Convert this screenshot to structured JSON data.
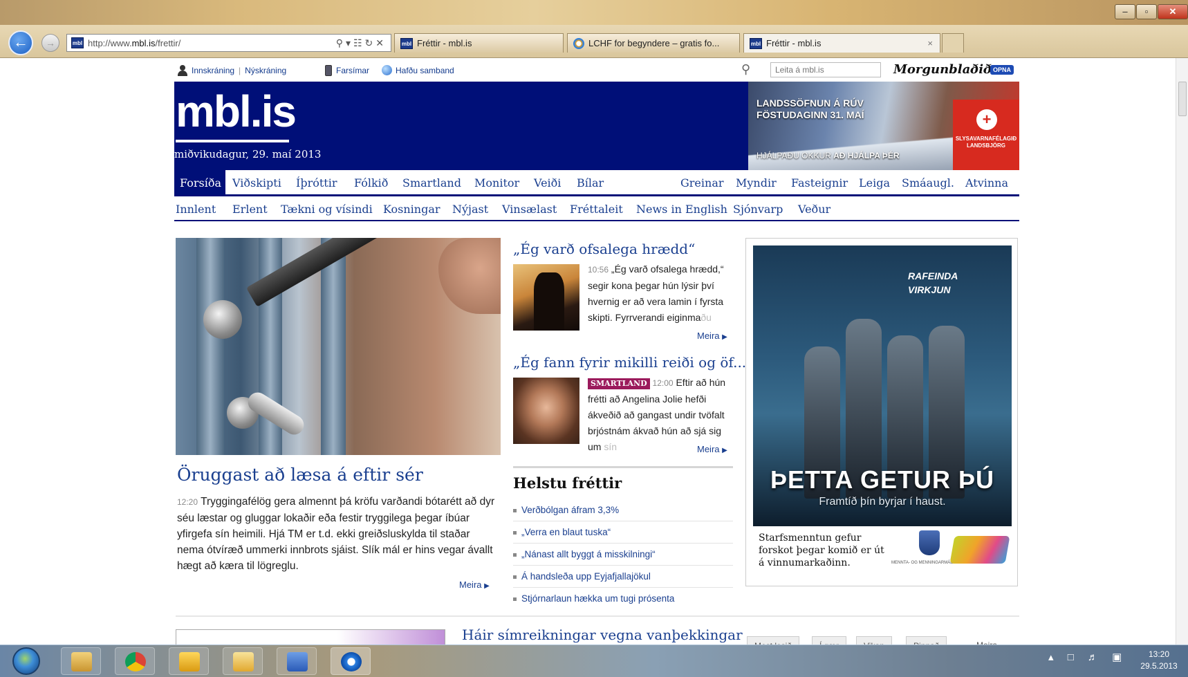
{
  "browser": {
    "address_url_prefix": "http://www.",
    "address_url_host": "mbl.is",
    "address_url_path": "/frettir/",
    "tabs": [
      {
        "label": "Fréttir - mbl.is",
        "favicon": "mbl-favicon"
      },
      {
        "label": "LCHF for begyndere – gratis fo...",
        "favicon": "ie-favicon"
      },
      {
        "label": "Fréttir - mbl.is",
        "favicon": "mbl-favicon",
        "active": true
      }
    ],
    "tab_close": "×",
    "window_buttons": {
      "minimize": "–",
      "maximize": "▫",
      "close": "✕"
    },
    "favicon_text": "mbl"
  },
  "utility": {
    "login": "Innskráning",
    "register": "Nýskráning",
    "divider": "|",
    "phones": "Farsímar",
    "contact": "Hafðu samband",
    "search_placeholder": "Leita á mbl.is",
    "newspaper": "Morgunblaðið",
    "opna": "OPNA"
  },
  "header": {
    "logo": "mbl.is",
    "date": "miðvikudagur, 29. maí 2013",
    "banner": {
      "line1": "LANDSSÖFNUN Á RÚV",
      "line2": "FÖSTUDAGINN 31. MAÍ",
      "line3_prefix": "HJÁLPAÐU OKKUR ",
      "line3_bold": "AÐ HJÁLPA ÞÉR",
      "org": "SLYSAVARNAFÉLAGIÐ LANDSBJÖRG",
      "accent": "#d72a1f"
    }
  },
  "main_nav": {
    "items": [
      "Forsíða",
      "Viðskipti",
      "Íþróttir",
      "Fólkið",
      "Smartland",
      "Monitor",
      "Veiði",
      "Bílar"
    ],
    "right_items": [
      "Greinar",
      "Myndir",
      "Fasteignir",
      "Leiga",
      "Smáaugl.",
      "Atvinna"
    ],
    "active": "Forsíða"
  },
  "sub_nav": {
    "items": [
      "Innlent",
      "Erlent",
      "Tækni og vísindi",
      "Kosningar",
      "Nýjast",
      "Vinsælast",
      "Fréttaleit",
      "News in English",
      "Sjónvarp",
      "Veður"
    ]
  },
  "lead": {
    "title": "Öruggast að læsa á eftir sér",
    "time": "12:20",
    "text": "Tryggingafélög gera almennt þá kröfu varðandi bótarétt að dyr séu læstar og gluggar lokaðir eða festir tryggilega þegar íbúar yfirgefa sín heimili. Hjá TM er t.d. ekki greiðsluskylda til staðar nema ótvíræð ummerki innbrots sjáist. Slík mál er hins vegar ávallt hægt að kæra til lögreglu.",
    "more": "Meira"
  },
  "story1": {
    "title": "„Ég varð ofsalega hrædd“",
    "time": "10:56",
    "text": "„Ég varð ofsalega hrædd,“ segir kona þegar hún lýsir því hvernig er að vera lamin í fyrsta skipti. Fyrrverandi eiginma",
    "fade": "ðu",
    "more": "Meira"
  },
  "story2": {
    "title": "„Ég fann fyrir mikilli reiði og öf...",
    "tag": "SMARTLAND",
    "time": "12:00",
    "text": "Eftir að hún frétti að Angelina Jolie hefði ákveðið að gangast undir tvöfalt brjóstnám ákvað hún að sjá sig um",
    "fade": "sín",
    "more": "Meira",
    "tag_color": "#9b1a5c"
  },
  "headlines": {
    "title": "Helstu fréttir",
    "items": [
      "Verðbólgan áfram 3,3%",
      "„Verra en blaut tuska“",
      "„Nánast allt byggt á misskilningi“",
      "Á handsleða upp Eyjafjallajökul",
      "Stjórnarlaun hækka um tugi prósenta"
    ]
  },
  "ad": {
    "label1": "RAFEINDA",
    "label2": "VIRKJUN",
    "headline": "ÞETTA GETUR ÞÚ",
    "subline": "Framtíð þín byrjar í haust.",
    "bottom1": "Starfsmenntun gefur",
    "bottom2": "forskot þegar komið er út",
    "bottom3": "á vinnumarkaðinn.",
    "ministry": "MENNTA- OG MENNINGARMÁLARÁÐUNEYTIÐ"
  },
  "lower": {
    "title": "Háir símreikningar vegna vanþekkingar",
    "tabs": [
      "Mest lesið",
      "Í gær",
      "Vikan",
      "Pinnað",
      "Meira"
    ]
  },
  "taskbar": {
    "time": "13:20",
    "date": "29.5.2013"
  }
}
